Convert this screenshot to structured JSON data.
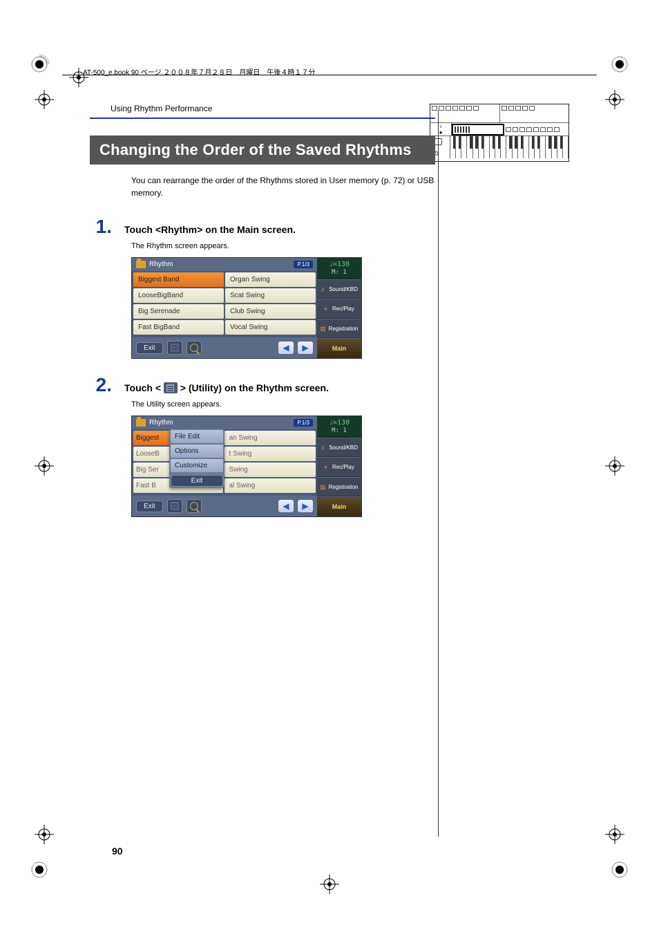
{
  "book_header": "AT-500_e.book  90 ページ  ２００８年７月２８日　月曜日　午後４時１７分",
  "section_header": "Using Rhythm Performance",
  "title": "Changing the Order of the Saved Rhythms",
  "intro": "You can rearrange the order of the Rhythms stored in User memory (p. 72) or USB memory.",
  "steps": [
    {
      "num": "1.",
      "title": "Touch <Rhythm> on the Main screen.",
      "desc": "The Rhythm screen appears."
    },
    {
      "num": "2.",
      "title_prefix": "Touch < ",
      "title_suffix": " > (Utility) on the Rhythm screen.",
      "desc": "The Utility screen appears."
    }
  ],
  "screen1": {
    "title": "Rhythm",
    "page_badge": "P.1/3",
    "rows": [
      [
        "Biggest Band",
        "Organ Swing"
      ],
      [
        "LooseBigBand",
        "Scat Swing"
      ],
      [
        "Big Serenade",
        "Club Swing"
      ],
      [
        "Fast BigBand",
        "Vocal Swing"
      ]
    ],
    "exit": "Exit",
    "tempo_top": "♩=130",
    "tempo_bot": "M:    1",
    "side": [
      "Sound/KBD",
      "Rec/Play",
      "Registration",
      "Main"
    ]
  },
  "screen2": {
    "title": "Rhythm",
    "page_badge": "P.1/3",
    "rows_left": [
      "Biggest",
      "LooseB",
      "Big Ser",
      "Fast B"
    ],
    "rows_right": [
      "an Swing",
      "t Swing",
      "  Swing",
      "al Swing"
    ],
    "popup": [
      "File Edit",
      "Options",
      "Customize"
    ],
    "popup_exit": "Exit",
    "exit": "Exit",
    "tempo_top": "♩=130",
    "tempo_bot": "M:    1",
    "side": [
      "Sound/KBD",
      "Rec/Play",
      "Registration",
      "Main"
    ]
  },
  "page_number": "90"
}
